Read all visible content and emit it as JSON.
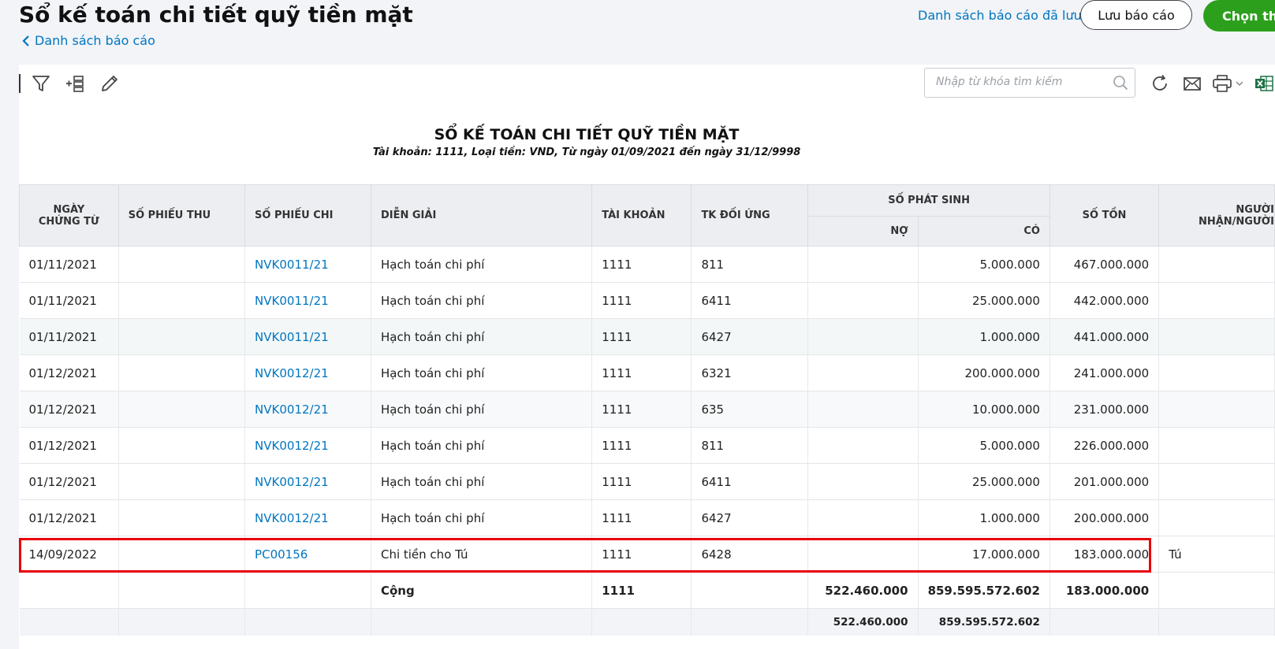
{
  "header": {
    "title": "Sổ kế toán chi tiết quỹ tiền mặt",
    "back_label": "Danh sách báo cáo",
    "saved_reports_label": "Danh sách báo cáo đã lưu",
    "save_label": "Lưu báo cáo",
    "choose_label": "Chọn tha"
  },
  "toolbar": {
    "search_placeholder": "Nhập từ khóa tìm kiếm",
    "icons": [
      "filter-icon",
      "add-column-icon",
      "edit-icon",
      "search-icon",
      "refresh-icon",
      "email-icon",
      "print-icon",
      "excel-icon"
    ]
  },
  "report": {
    "title": "SỔ KẾ TOÁN CHI TIẾT QUỸ TIỀN MẶT",
    "subtitle": "Tài khoản: 1111, Loại tiền: VND, Từ ngày 01/09/2021 đến ngày 31/12/9998"
  },
  "table": {
    "headers": {
      "date_line1": "NGÀY",
      "date_line2": "CHỨNG TỪ",
      "receipt_no": "SỐ PHIẾU THU",
      "payment_no": "SỐ PHIẾU CHI",
      "description": "DIỄN GIẢI",
      "account": "TÀI KHOẢN",
      "counter_account": "TK ĐỐI ỨNG",
      "arising": "SỐ PHÁT SINH",
      "debit": "NỢ",
      "credit": "CÓ",
      "balance": "SỐ TỒN",
      "person_line1": "NGƯỜI",
      "person_line2": "NHẬN/NGƯỜI"
    },
    "rows": [
      {
        "date": "01/11/2021",
        "receipt": "",
        "payment": "NVK0011/21",
        "desc": "Hạch toán chi phí",
        "account": "1111",
        "counter": "811",
        "debit": "",
        "credit": "5.000.000",
        "balance": "467.000.000",
        "person": ""
      },
      {
        "date": "01/11/2021",
        "receipt": "",
        "payment": "NVK0011/21",
        "desc": "Hạch toán chi phí",
        "account": "1111",
        "counter": "6411",
        "debit": "",
        "credit": "25.000.000",
        "balance": "442.000.000",
        "person": ""
      },
      {
        "date": "01/11/2021",
        "receipt": "",
        "payment": "NVK0011/21",
        "desc": "Hạch toán chi phí",
        "account": "1111",
        "counter": "6427",
        "debit": "",
        "credit": "1.000.000",
        "balance": "441.000.000",
        "person": ""
      },
      {
        "date": "01/12/2021",
        "receipt": "",
        "payment": "NVK0012/21",
        "desc": "Hạch toán chi phí",
        "account": "1111",
        "counter": "6321",
        "debit": "",
        "credit": "200.000.000",
        "balance": "241.000.000",
        "person": ""
      },
      {
        "date": "01/12/2021",
        "receipt": "",
        "payment": "NVK0012/21",
        "desc": "Hạch toán chi phí",
        "account": "1111",
        "counter": "635",
        "debit": "",
        "credit": "10.000.000",
        "balance": "231.000.000",
        "person": ""
      },
      {
        "date": "01/12/2021",
        "receipt": "",
        "payment": "NVK0012/21",
        "desc": "Hạch toán chi phí",
        "account": "1111",
        "counter": "811",
        "debit": "",
        "credit": "5.000.000",
        "balance": "226.000.000",
        "person": ""
      },
      {
        "date": "01/12/2021",
        "receipt": "",
        "payment": "NVK0012/21",
        "desc": "Hạch toán chi phí",
        "account": "1111",
        "counter": "6411",
        "debit": "",
        "credit": "25.000.000",
        "balance": "201.000.000",
        "person": ""
      },
      {
        "date": "01/12/2021",
        "receipt": "",
        "payment": "NVK0012/21",
        "desc": "Hạch toán chi phí",
        "account": "1111",
        "counter": "6427",
        "debit": "",
        "credit": "1.000.000",
        "balance": "200.000.000",
        "person": ""
      },
      {
        "date": "14/09/2022",
        "receipt": "",
        "payment": "PC00156",
        "desc": "Chi tiền cho Tú",
        "account": "1111",
        "counter": "6428",
        "debit": "",
        "credit": "17.000.000",
        "balance": "183.000.000",
        "person": "Tú"
      }
    ],
    "total": {
      "label": "Cộng",
      "account": "1111",
      "debit": "522.460.000",
      "credit": "859.595.572.602",
      "balance": "183.000.000"
    },
    "grand_total": {
      "debit": "522.460.000",
      "credit": "859.595.572.602"
    }
  },
  "colors": {
    "accent_green": "#2ca01c",
    "link_blue": "#0075c0",
    "highlight_red": "#e8000b"
  }
}
